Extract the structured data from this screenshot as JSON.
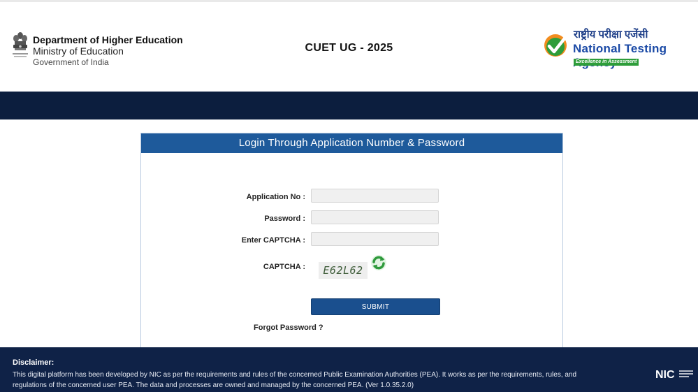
{
  "header": {
    "dept_line1": "Department of Higher Education",
    "dept_line2": "Ministry of Education",
    "dept_line3": "Government of India",
    "page_title": "CUET UG - 2025",
    "nta_hindi": "राष्ट्रीय परीक्षा एजेंसी",
    "nta_name": "National Testing Agency",
    "nta_tagline": "Excellence in Assessment"
  },
  "login": {
    "title": "Login Through Application Number & Password",
    "application_label": "Application No :",
    "application_value": "",
    "password_label": "Password :",
    "password_value": "",
    "captcha_input_label": "Enter CAPTCHA :",
    "captcha_input_value": "",
    "captcha_label": "CAPTCHA :",
    "captcha_text": "E62L62",
    "refresh_icon": "refresh-icon",
    "submit_label": "SUBMIT",
    "forgot_label": "Forgot Password ?"
  },
  "footer": {
    "disclaimer_title": "Disclaimer:",
    "disclaimer_text": "This digital platform has been developed by NIC as per the requirements and rules of the concerned Public Examination Authorities (PEA). It works as per the requirements, rules, and regulations of the concerned user PEA. The data and processes are owned and managed by the concerned PEA. (Ver 1.0.35.2.0)",
    "nic_label": "NIC"
  },
  "colors": {
    "primary_blue": "#1e5a9b",
    "nav_dark": "#0c1e3e",
    "footer_dark": "#0f2247",
    "submit_blue": "#1a4f8e",
    "nta_green": "#2e9d3a",
    "nta_orange": "#f28c1e"
  }
}
